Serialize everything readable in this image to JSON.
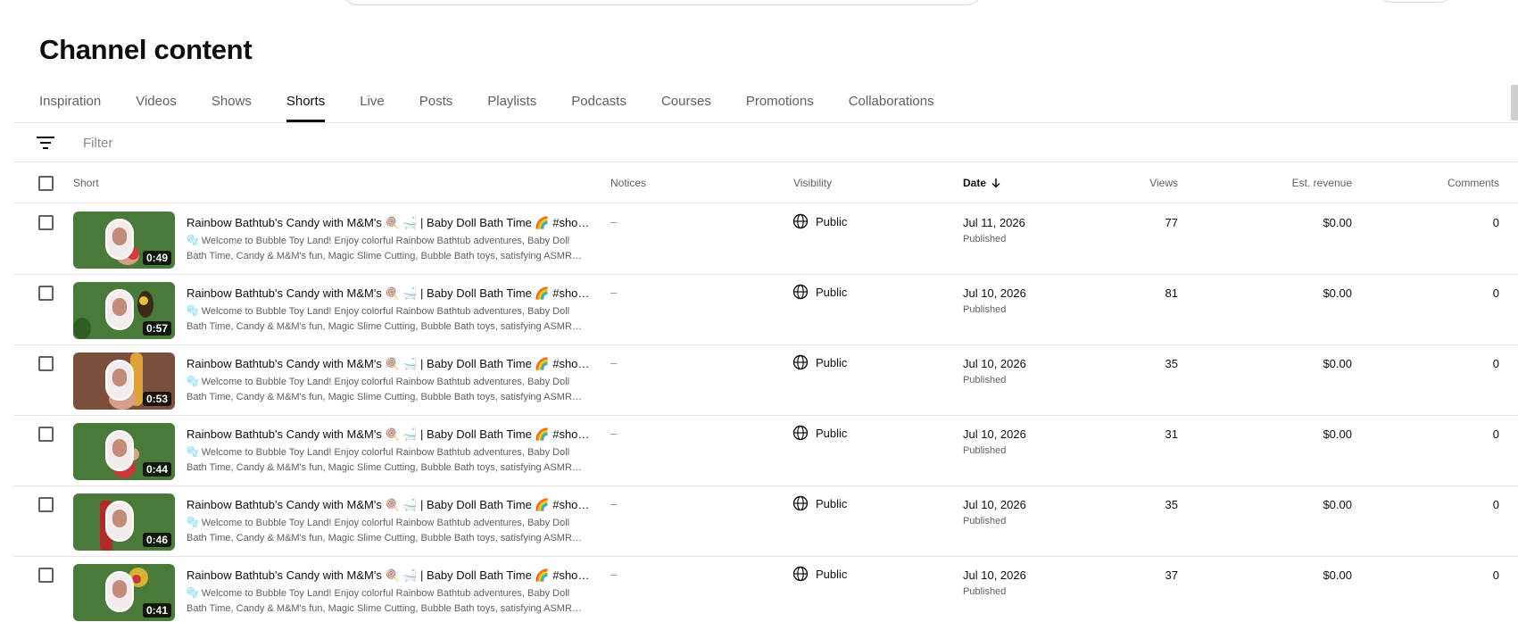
{
  "page": {
    "title": "Channel content"
  },
  "tabs": [
    {
      "label": "Inspiration",
      "active": false
    },
    {
      "label": "Videos",
      "active": false
    },
    {
      "label": "Shows",
      "active": false
    },
    {
      "label": "Shorts",
      "active": true
    },
    {
      "label": "Live",
      "active": false
    },
    {
      "label": "Posts",
      "active": false
    },
    {
      "label": "Playlists",
      "active": false
    },
    {
      "label": "Podcasts",
      "active": false
    },
    {
      "label": "Courses",
      "active": false
    },
    {
      "label": "Promotions",
      "active": false
    },
    {
      "label": "Collaborations",
      "active": false
    }
  ],
  "filter": {
    "placeholder": "Filter",
    "icon": "filter-icon"
  },
  "columns": {
    "short": "Short",
    "notices": "Notices",
    "visibility": "Visibility",
    "date": "Date",
    "views": "Views",
    "revenue": "Est. revenue",
    "comments": "Comments"
  },
  "sort": {
    "column": "date",
    "direction": "descending"
  },
  "rows": [
    {
      "title": "Rainbow Bathtub's Candy with M&M's 🍭 🛁 | Baby Doll Bath Time 🌈 #sho…",
      "description": "🫧 Welcome to Bubble Toy Land! Enjoy colorful Rainbow Bathtub adventures, Baby Doll Bath Time, Candy & M&M's fun, Magic Slime Cutting, Bubble Bath toys, satisfying ASMR…",
      "duration": "0:49",
      "notice": "–",
      "visibility": "Public",
      "date": "Jul 11, 2026",
      "status": "Published",
      "views": "77",
      "revenue": "$0.00",
      "comments": "0"
    },
    {
      "title": "Rainbow Bathtub's Candy with M&M's 🍭 🛁 | Baby Doll Bath Time 🌈 #sho…",
      "description": "🫧 Welcome to Bubble Toy Land! Enjoy colorful Rainbow Bathtub adventures, Baby Doll Bath Time, Candy & M&M's fun, Magic Slime Cutting, Bubble Bath toys, satisfying ASMR…",
      "duration": "0:57",
      "notice": "–",
      "visibility": "Public",
      "date": "Jul 10, 2026",
      "status": "Published",
      "views": "81",
      "revenue": "$0.00",
      "comments": "0"
    },
    {
      "title": "Rainbow Bathtub's Candy with M&M's 🍭 🛁 | Baby Doll Bath Time 🌈 #sho…",
      "description": "🫧 Welcome to Bubble Toy Land! Enjoy colorful Rainbow Bathtub adventures, Baby Doll Bath Time, Candy & M&M's fun, Magic Slime Cutting, Bubble Bath toys, satisfying ASMR…",
      "duration": "0:53",
      "notice": "–",
      "visibility": "Public",
      "date": "Jul 10, 2026",
      "status": "Published",
      "views": "35",
      "revenue": "$0.00",
      "comments": "0"
    },
    {
      "title": "Rainbow Bathtub's Candy with M&M's 🍭 🛁 | Baby Doll Bath Time 🌈 #sho…",
      "description": "🫧 Welcome to Bubble Toy Land! Enjoy colorful Rainbow Bathtub adventures, Baby Doll Bath Time, Candy & M&M's fun, Magic Slime Cutting, Bubble Bath toys, satisfying ASMR…",
      "duration": "0:44",
      "notice": "–",
      "visibility": "Public",
      "date": "Jul 10, 2026",
      "status": "Published",
      "views": "31",
      "revenue": "$0.00",
      "comments": "0"
    },
    {
      "title": "Rainbow Bathtub's Candy with M&M's 🍭 🛁 | Baby Doll Bath Time 🌈 #sho…",
      "description": "🫧 Welcome to Bubble Toy Land! Enjoy colorful Rainbow Bathtub adventures, Baby Doll Bath Time, Candy & M&M's fun, Magic Slime Cutting, Bubble Bath toys, satisfying ASMR…",
      "duration": "0:46",
      "notice": "–",
      "visibility": "Public",
      "date": "Jul 10, 2026",
      "status": "Published",
      "views": "35",
      "revenue": "$0.00",
      "comments": "0"
    },
    {
      "title": "Rainbow Bathtub's Candy with M&M's 🍭 🛁 | Baby Doll Bath Time 🌈 #sho…",
      "description": "🫧 Welcome to Bubble Toy Land! Enjoy colorful Rainbow Bathtub adventures, Baby Doll Bath Time, Candy & M&M's fun, Magic Slime Cutting, Bubble Bath toys, satisfying ASMR…",
      "duration": "0:41",
      "notice": "–",
      "visibility": "Public",
      "date": "Jul 10, 2026",
      "status": "Published",
      "views": "37",
      "revenue": "$0.00",
      "comments": "0"
    }
  ],
  "colors": {
    "text_primary": "#0f0f0f",
    "text_secondary": "#606060",
    "divider": "#e5e5e5",
    "thumbnail_green": "#4a7a3a",
    "thumbnail_brown": "#7a4f3c"
  }
}
